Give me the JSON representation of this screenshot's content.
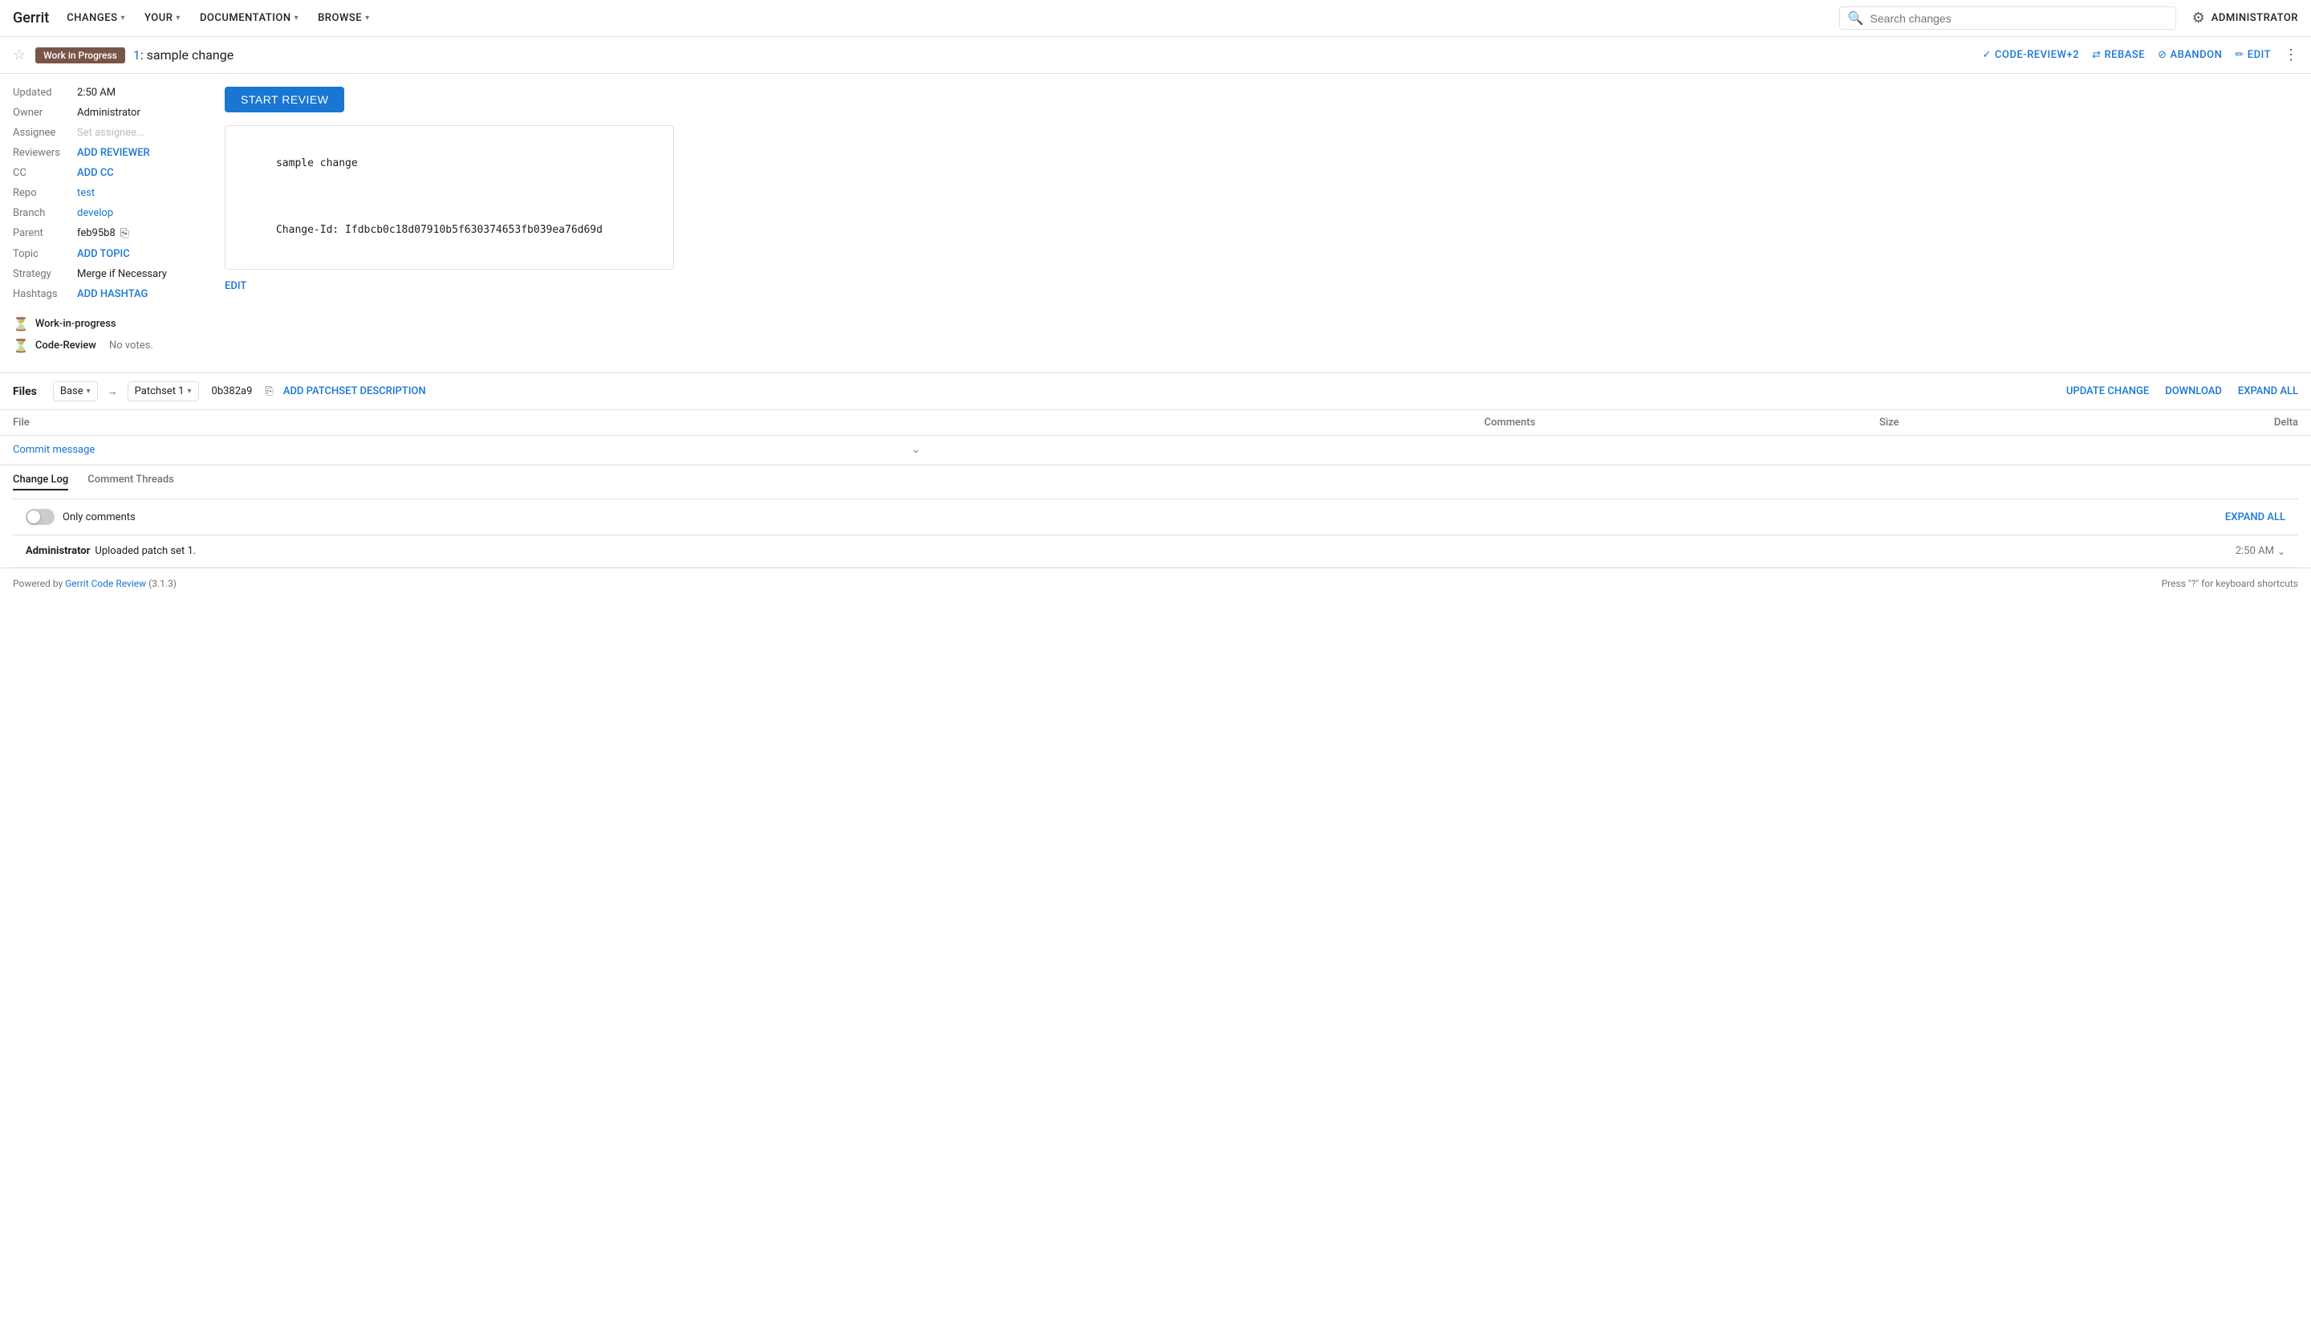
{
  "nav": {
    "logo": "Gerrit",
    "items": [
      {
        "label": "CHANGES",
        "id": "changes"
      },
      {
        "label": "YOUR",
        "id": "your"
      },
      {
        "label": "DOCUMENTATION",
        "id": "documentation"
      },
      {
        "label": "BROWSE",
        "id": "browse"
      }
    ],
    "search_placeholder": "Search changes",
    "settings_label": "ADMINISTRATOR"
  },
  "change_header": {
    "star_label": "☆",
    "wip_badge": "Work in Progress",
    "change_number": "1",
    "change_title": ": sample change",
    "actions": {
      "code_review": "CODE-REVIEW+2",
      "rebase": "REBASE",
      "abandon": "ABANDON",
      "edit": "EDIT"
    }
  },
  "metadata": {
    "updated_label": "Updated",
    "updated_value": "2:50 AM",
    "owner_label": "Owner",
    "owner_value": "Administrator",
    "assignee_label": "Assignee",
    "assignee_placeholder": "Set assignee...",
    "reviewers_label": "Reviewers",
    "reviewers_action": "ADD REVIEWER",
    "cc_label": "CC",
    "cc_action": "ADD CC",
    "repo_label": "Repo",
    "repo_value": "test",
    "branch_label": "Branch",
    "branch_value": "develop",
    "parent_label": "Parent",
    "parent_value": "feb95b8",
    "topic_label": "Topic",
    "topic_action": "ADD TOPIC",
    "strategy_label": "Strategy",
    "strategy_value": "Merge if Necessary",
    "hashtags_label": "Hashtags",
    "hashtags_action": "ADD HASHTAG"
  },
  "commit_message": {
    "start_review_label": "START REVIEW",
    "message_line1": "sample change",
    "message_line2": "",
    "message_line3": "Change-Id: Ifdbcb0c18d07910b5f630374653fb039ea76d69d",
    "edit_label": "EDIT"
  },
  "scores": [
    {
      "icon": "⏳",
      "label": "Work-in-progress",
      "value": ""
    },
    {
      "icon": "⏳",
      "label": "Code-Review",
      "value": "No votes."
    }
  ],
  "files": {
    "title": "Files",
    "base_label": "Base",
    "arrow": "→",
    "patchset_label": "Patchset 1",
    "patchset_hash": "0b382a9",
    "add_patchset_desc": "ADD PATCHSET DESCRIPTION",
    "actions": {
      "update_change": "UPDATE CHANGE",
      "download": "DOWNLOAD",
      "expand_all": "EXPAND ALL"
    },
    "columns": {
      "file": "File",
      "comments": "Comments",
      "size": "Size",
      "delta": "Delta"
    },
    "rows": [
      {
        "name": "Commit message",
        "comments": "",
        "size": "",
        "delta": ""
      }
    ]
  },
  "change_log": {
    "tabs": [
      {
        "label": "Change Log",
        "active": true
      },
      {
        "label": "Comment Threads",
        "active": false
      }
    ],
    "only_comments_label": "Only comments",
    "expand_all_label": "EXPAND ALL",
    "entries": [
      {
        "user": "Administrator",
        "message": "Uploaded patch set 1.",
        "time": "2:50 AM"
      }
    ]
  },
  "footer": {
    "powered_by": "Powered by ",
    "link_text": "Gerrit Code Review",
    "version": " (3.1.3)",
    "shortcuts": "Press \"?\" for keyboard shortcuts"
  }
}
